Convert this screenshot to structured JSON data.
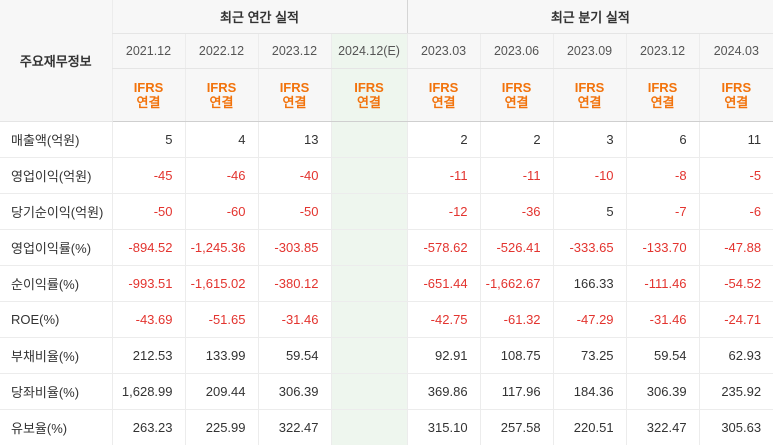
{
  "header": {
    "corner_label": "주요재무정보",
    "annual_group": "최근 연간 실적",
    "quarterly_group": "최근 분기 실적",
    "ifrs_line1": "IFRS",
    "ifrs_line2": "연결",
    "periods": [
      "2021.12",
      "2022.12",
      "2023.12",
      "2024.12(E)",
      "2023.03",
      "2023.06",
      "2023.09",
      "2023.12",
      "2024.03"
    ]
  },
  "rows": [
    {
      "label": "매출액(억원)",
      "values": [
        "5",
        "4",
        "13",
        "",
        "2",
        "2",
        "3",
        "6",
        "11"
      ]
    },
    {
      "label": "영업이익(억원)",
      "values": [
        "-45",
        "-46",
        "-40",
        "",
        "-11",
        "-11",
        "-10",
        "-8",
        "-5"
      ]
    },
    {
      "label": "당기순이익(억원)",
      "values": [
        "-50",
        "-60",
        "-50",
        "",
        "-12",
        "-36",
        "5",
        "-7",
        "-6"
      ]
    },
    {
      "label": "영업이익률(%)",
      "values": [
        "-894.52",
        "-1,245.36",
        "-303.85",
        "",
        "-578.62",
        "-526.41",
        "-333.65",
        "-133.70",
        "-47.88"
      ]
    },
    {
      "label": "순이익률(%)",
      "values": [
        "-993.51",
        "-1,615.02",
        "-380.12",
        "",
        "-651.44",
        "-1,662.67",
        "166.33",
        "-111.46",
        "-54.52"
      ]
    },
    {
      "label": "ROE(%)",
      "values": [
        "-43.69",
        "-51.65",
        "-31.46",
        "",
        "-42.75",
        "-61.32",
        "-47.29",
        "-31.46",
        "-24.71"
      ]
    },
    {
      "label": "부채비율(%)",
      "values": [
        "212.53",
        "133.99",
        "59.54",
        "",
        "92.91",
        "108.75",
        "73.25",
        "59.54",
        "62.93"
      ]
    },
    {
      "label": "당좌비율(%)",
      "values": [
        "1,628.99",
        "209.44",
        "306.39",
        "",
        "369.86",
        "117.96",
        "184.36",
        "306.39",
        "235.92"
      ]
    },
    {
      "label": "유보율(%)",
      "values": [
        "263.23",
        "225.99",
        "322.47",
        "",
        "315.10",
        "257.58",
        "220.51",
        "322.47",
        "305.63"
      ]
    }
  ],
  "colors": {
    "negative": "#e3342f",
    "ifrs": "#f2730c",
    "estimate_bg": "#eef6ee",
    "header_bg": "#f7f7f7"
  }
}
